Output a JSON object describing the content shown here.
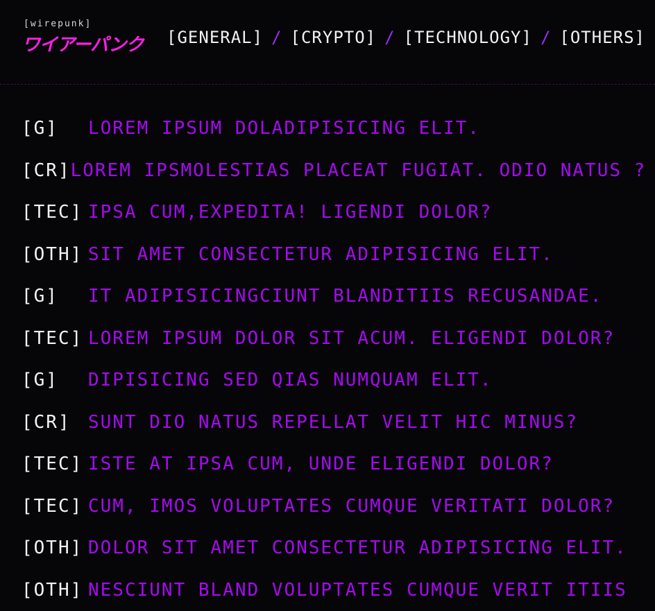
{
  "brand": {
    "small": "[wirepunk]",
    "logo": "ワイアーパンク",
    "logo_color": "#ff1ee8"
  },
  "nav": {
    "items": [
      "[GENERAL]",
      "[CRYPTO]",
      "[TECHNOLOGY]",
      "[OTHERS]"
    ],
    "separator": "/",
    "separator_color": "#9a2dff"
  },
  "articles": [
    {
      "tag": "[G]",
      "title": "LOREM IPSUM DOLADIPISICING ELIT."
    },
    {
      "tag": "[CR]",
      "title": "LOREM IPSMOLESTIAS PLACEAT FUGIAT. ODIO NATUS ?"
    },
    {
      "tag": "[TEC]",
      "title": "IPSA CUM,EXPEDITA! LIGENDI DOLOR?"
    },
    {
      "tag": "[OTH]",
      "title": "SIT AMET CONSECTETUR ADIPISICING ELIT."
    },
    {
      "tag": "[G]",
      "title": "IT ADIPISICINGCIUNT BLANDITIIS RECUSANDAE."
    },
    {
      "tag": "[TEC]",
      "title": "LOREM IPSUM DOLOR SIT ACUM. ELIGENDI DOLOR?"
    },
    {
      "tag": "[G]",
      "title": "DIPISICING SED QIAS NUMQUAM ELIT."
    },
    {
      "tag": "[CR]",
      "title": "SUNT DIO NATUS REPELLAT VELIT HIC MINUS?"
    },
    {
      "tag": "[TEC]",
      "title": "ISTE AT IPSA CUM, UNDE ELIGENDI DOLOR?"
    },
    {
      "tag": "[TEC]",
      "title": "CUM, IMOS VOLUPTATES CUMQUE VERITATI DOLOR?"
    },
    {
      "tag": "[OTH]",
      "title": "DOLOR SIT AMET CONSECTETUR ADIPISICING ELIT."
    },
    {
      "tag": "[OTH]",
      "title": "NESCIUNT BLAND VOLUPTATES CUMQUE VERIT ITIIS"
    }
  ],
  "colors": {
    "background": "#060507",
    "tag_text": "#f2f2f2",
    "title_text": "#a40bf0"
  }
}
